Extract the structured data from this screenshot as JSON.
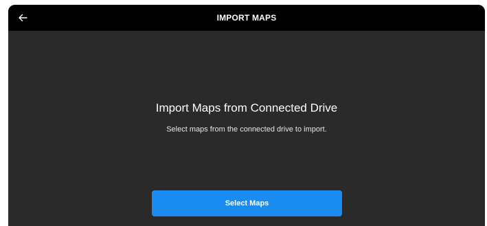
{
  "header": {
    "title": "IMPORT MAPS",
    "back_icon": "arrow-left-icon"
  },
  "main": {
    "heading": "Import Maps from Connected Drive",
    "subheading": "Select maps from the connected drive to import.",
    "select_button_label": "Select Maps"
  },
  "colors": {
    "topbar_bg": "#000000",
    "panel_bg": "#2a2a2a",
    "accent": "#1a8cf0",
    "text": "#ffffff"
  }
}
